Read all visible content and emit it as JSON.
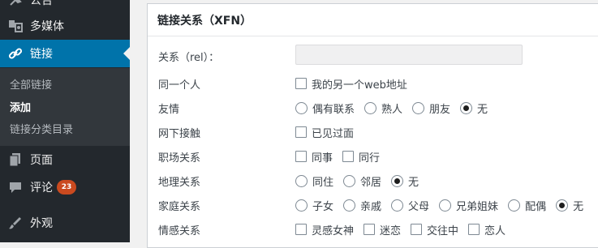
{
  "sidebar": {
    "items": [
      {
        "label": "公告",
        "icon": "pin-icon"
      },
      {
        "label": "多媒体",
        "icon": "media-icon"
      },
      {
        "label": "链接",
        "icon": "link-icon"
      },
      {
        "label": "页面",
        "icon": "page-icon"
      },
      {
        "label": "评论",
        "icon": "comment-icon",
        "badge": "23"
      },
      {
        "label": "外观",
        "icon": "appearance-icon"
      }
    ],
    "submenu": [
      "全部链接",
      "添加",
      "链接分类目录"
    ]
  },
  "panel": {
    "title": "链接关系（XFN）",
    "rel_label": "关系（rel）：",
    "rel_value": "",
    "rows": [
      {
        "label": "同一个人",
        "type": "checkbox",
        "options": [
          {
            "label": "我的另一个web地址",
            "checked": false
          }
        ]
      },
      {
        "label": "友情",
        "type": "radio",
        "options": [
          {
            "label": "偶有联系",
            "checked": false
          },
          {
            "label": "熟人",
            "checked": false
          },
          {
            "label": "朋友",
            "checked": false
          },
          {
            "label": "无",
            "checked": true
          }
        ]
      },
      {
        "label": "网下接触",
        "type": "checkbox",
        "options": [
          {
            "label": "已见过面",
            "checked": false
          }
        ]
      },
      {
        "label": "职场关系",
        "type": "checkbox",
        "options": [
          {
            "label": "同事",
            "checked": false
          },
          {
            "label": "同行",
            "checked": false
          }
        ]
      },
      {
        "label": "地理关系",
        "type": "radio",
        "options": [
          {
            "label": "同住",
            "checked": false
          },
          {
            "label": "邻居",
            "checked": false
          },
          {
            "label": "无",
            "checked": true
          }
        ]
      },
      {
        "label": "家庭关系",
        "type": "radio",
        "options": [
          {
            "label": "子女",
            "checked": false
          },
          {
            "label": "亲戚",
            "checked": false
          },
          {
            "label": "父母",
            "checked": false
          },
          {
            "label": "兄弟姐妹",
            "checked": false
          },
          {
            "label": "配偶",
            "checked": false
          },
          {
            "label": "无",
            "checked": true
          }
        ]
      },
      {
        "label": "情感关系",
        "type": "checkbox",
        "options": [
          {
            "label": "灵感女神",
            "checked": false
          },
          {
            "label": "迷恋",
            "checked": false
          },
          {
            "label": "交往中",
            "checked": false
          },
          {
            "label": "恋人",
            "checked": false
          }
        ]
      }
    ]
  },
  "colors": {
    "sidebar_bg": "#23282d",
    "submenu_bg": "#32373c",
    "accent": "#0073aa",
    "badge": "#ca4a1f"
  }
}
